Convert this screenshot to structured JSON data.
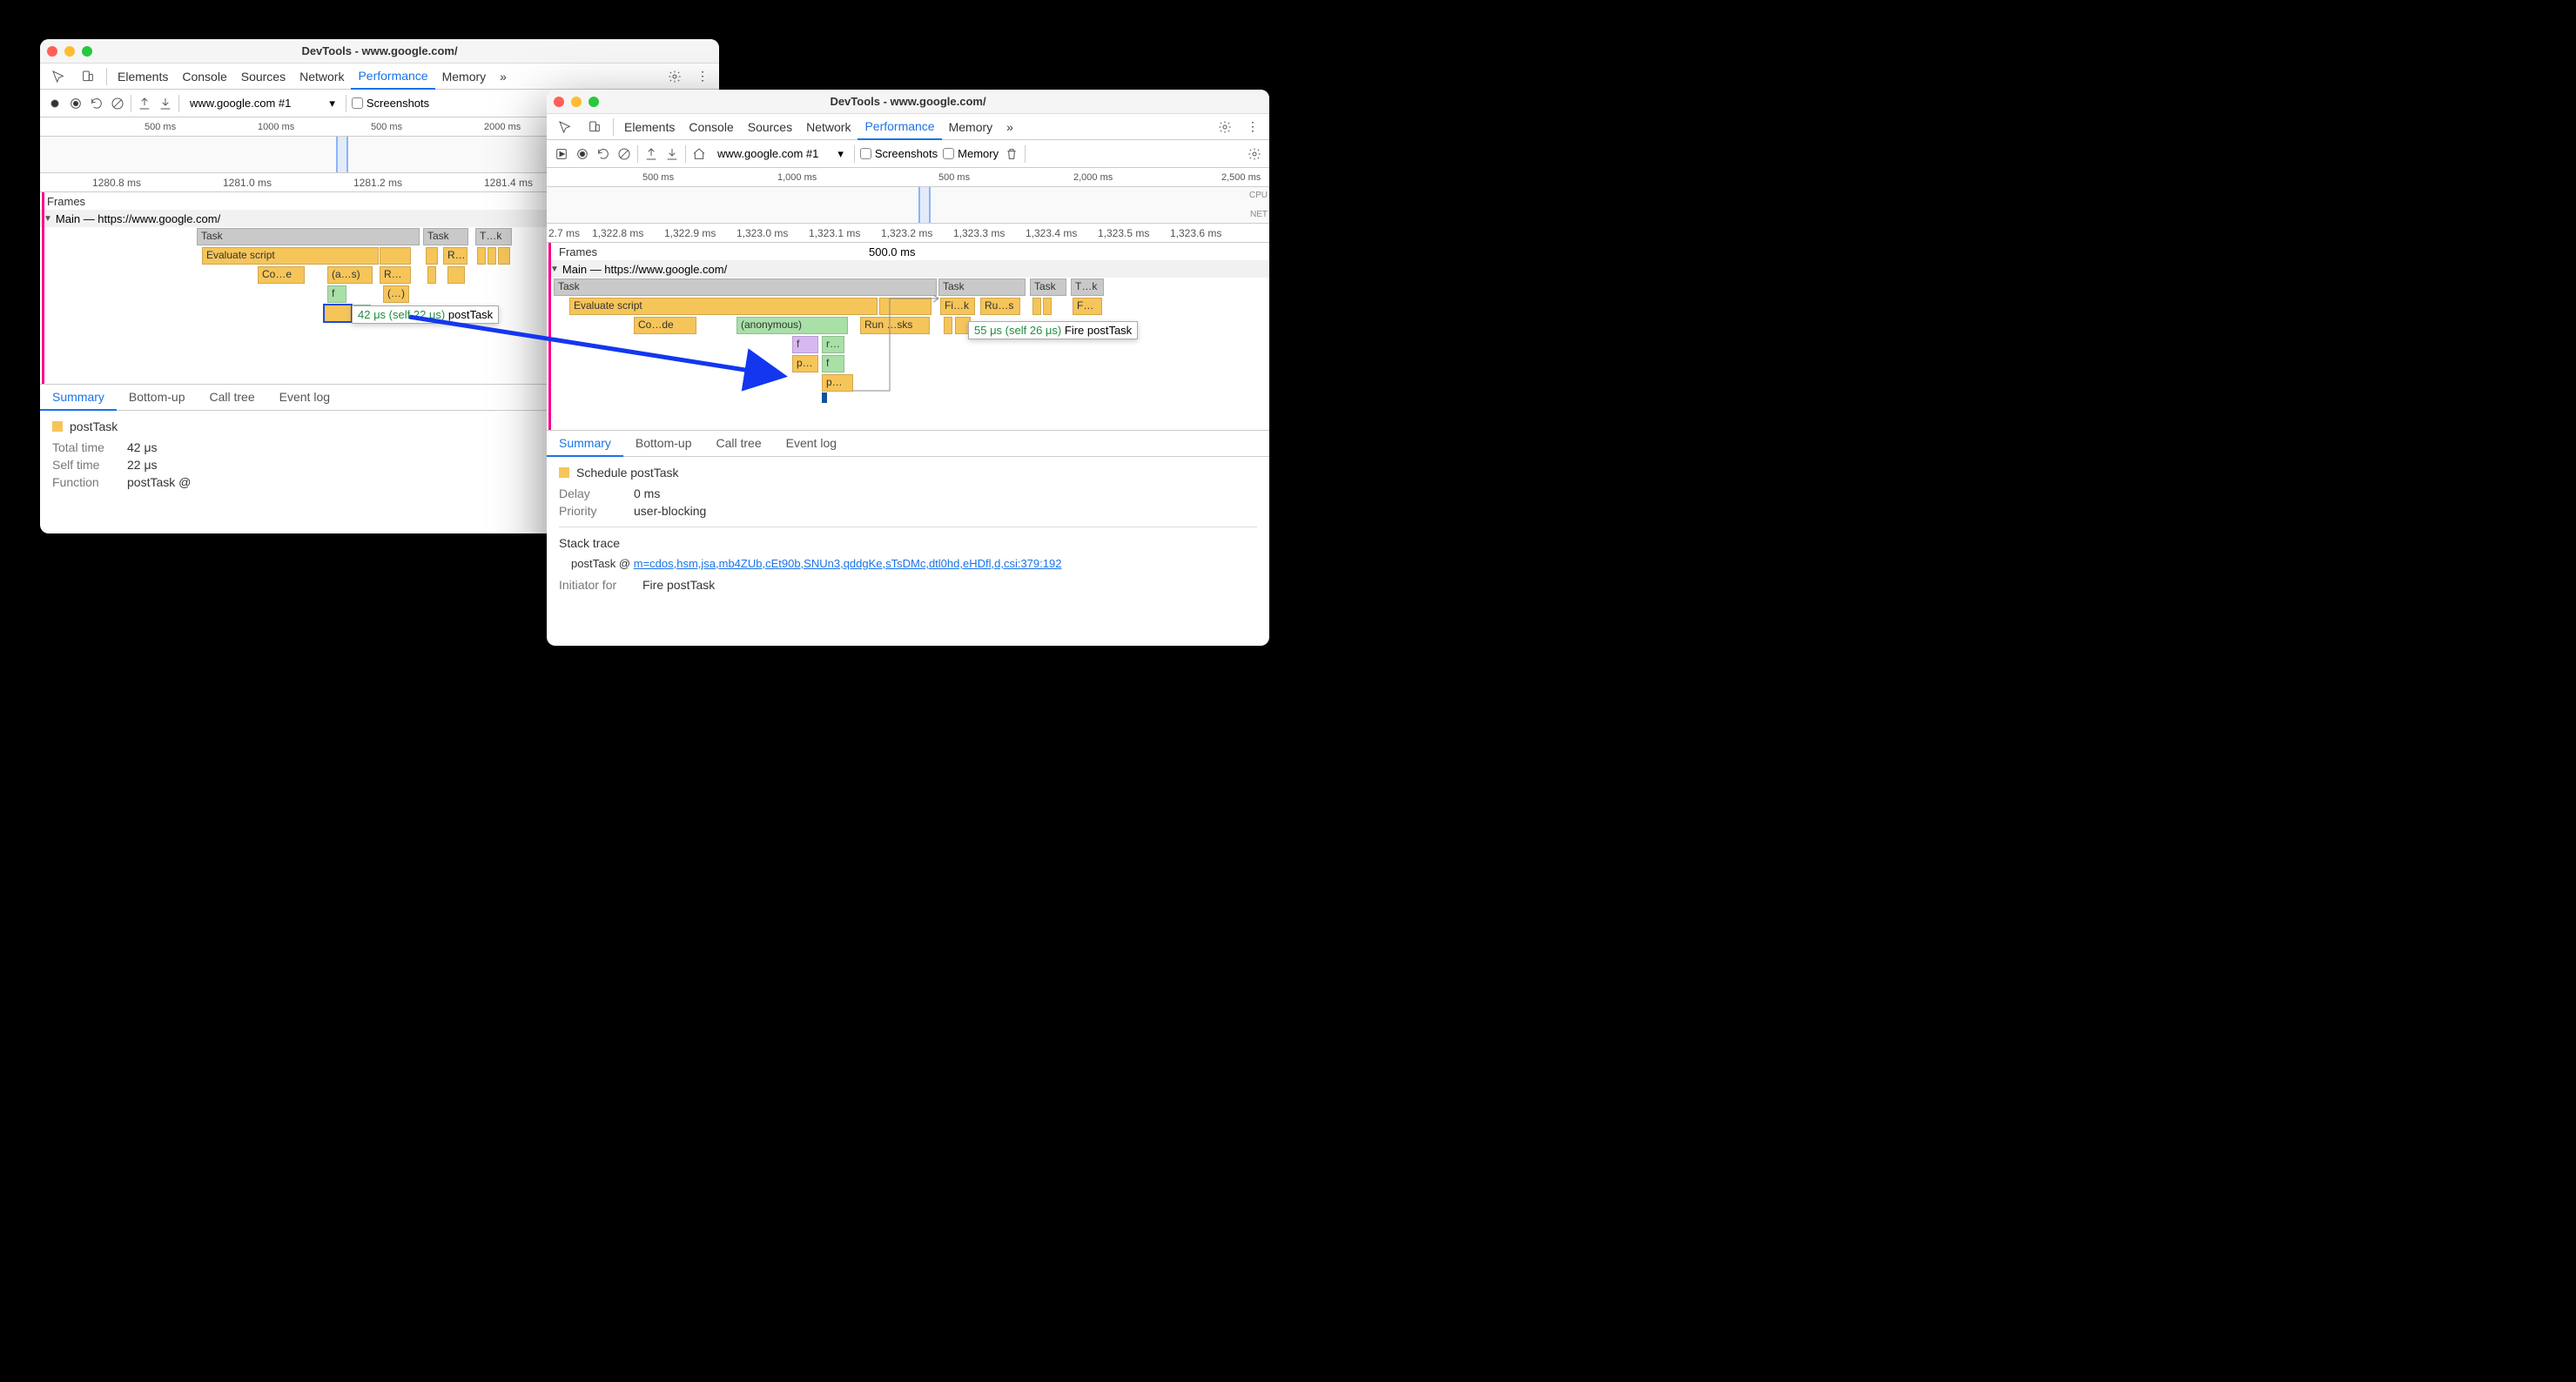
{
  "w1": {
    "title": "DevTools - www.google.com/",
    "tabs": {
      "elements": "Elements",
      "console": "Console",
      "sources": "Sources",
      "network": "Network",
      "performance": "Performance",
      "memory": "Memory"
    },
    "subbar": {
      "recordTarget": "www.google.com #1",
      "screenshots": "Screenshots"
    },
    "overviewTicks": {
      "t1": "500 ms",
      "t2": "1000 ms",
      "t3": "500 ms",
      "t4": "2000 ms"
    },
    "flameRuler": {
      "t1": "1280.8 ms",
      "t2": "1281.0 ms",
      "t3": "1281.2 ms",
      "t4": "1281.4 ms"
    },
    "tracks": {
      "frames": "Frames",
      "main": "Main — https://www.google.com/",
      "bars": {
        "task1": "Task",
        "task2": "Task",
        "task3": "T…k",
        "eval": "Evaluate script",
        "r": "R…",
        "co": "Co…e",
        "anon": "(a…s)",
        "rs": "R…s",
        "f": "f",
        "paren": "(…)"
      }
    },
    "tooltip": {
      "time": "42 μs (self 22 μs)",
      "label": "postTask"
    },
    "detailTabs": {
      "summary": "Summary",
      "bottomup": "Bottom-up",
      "calltree": "Call tree",
      "eventlog": "Event log"
    },
    "details": {
      "title": "postTask",
      "totalLabel": "Total time",
      "total": "42 μs",
      "selfLabel": "Self time",
      "self": "22 μs",
      "funcLabel": "Function",
      "func": "postTask @"
    }
  },
  "w2": {
    "title": "DevTools - www.google.com/",
    "tabs": {
      "elements": "Elements",
      "console": "Console",
      "sources": "Sources",
      "network": "Network",
      "performance": "Performance",
      "memory": "Memory"
    },
    "subbar": {
      "recordTarget": "www.google.com #1",
      "screenshots": "Screenshots",
      "memory": "Memory"
    },
    "overviewTicks": {
      "t1": "500 ms",
      "t2": "1,000 ms",
      "t3": "500 ms",
      "t4": "2,000 ms",
      "t5": "2,500 ms"
    },
    "flameRuler": {
      "t0": "2.7 ms",
      "t1": "1,322.8 ms",
      "t2": "1,322.9 ms",
      "t3": "1,323.0 ms",
      "t4": "1,323.1 ms",
      "t5": "1,323.2 ms",
      "t6": "1,323.3 ms",
      "t7": "1,323.4 ms",
      "t8": "1,323.5 ms",
      "t9": "1,323.6 ms"
    },
    "tracks": {
      "frames": "Frames",
      "framesDur": "500.0 ms",
      "main": "Main — https://www.google.com/",
      "cpu": "CPU",
      "net": "NET",
      "bars": {
        "task1": "Task",
        "task2": "Task",
        "task3": "Task",
        "task4": "T…k",
        "eval": "Evaluate script",
        "fi": "Fi…k",
        "ru": "Ru…s",
        "fk": "F…k",
        "code": "Co…de",
        "anon": "(anonymous)",
        "run": "Run …sks",
        "f": "f",
        "r": "r…",
        "p": "p…",
        "f2": "f",
        "p2": "p…"
      }
    },
    "tooltip": {
      "time": "55 μs (self 26 μs)",
      "label": "Fire postTask"
    },
    "detailTabs": {
      "summary": "Summary",
      "bottomup": "Bottom-up",
      "calltree": "Call tree",
      "eventlog": "Event log"
    },
    "details": {
      "title": "Schedule postTask",
      "delayLabel": "Delay",
      "delay": "0 ms",
      "prioLabel": "Priority",
      "prio": "user-blocking",
      "stackLabel": "Stack trace",
      "stackFrame": "postTask @ ",
      "stackLink": "m=cdos,hsm,jsa,mb4ZUb,cEt90b,SNUn3,qddgKe,sTsDMc,dtl0hd,eHDfl,d,csi:379:192",
      "initLabel": "Initiator for",
      "init": "Fire postTask"
    }
  }
}
